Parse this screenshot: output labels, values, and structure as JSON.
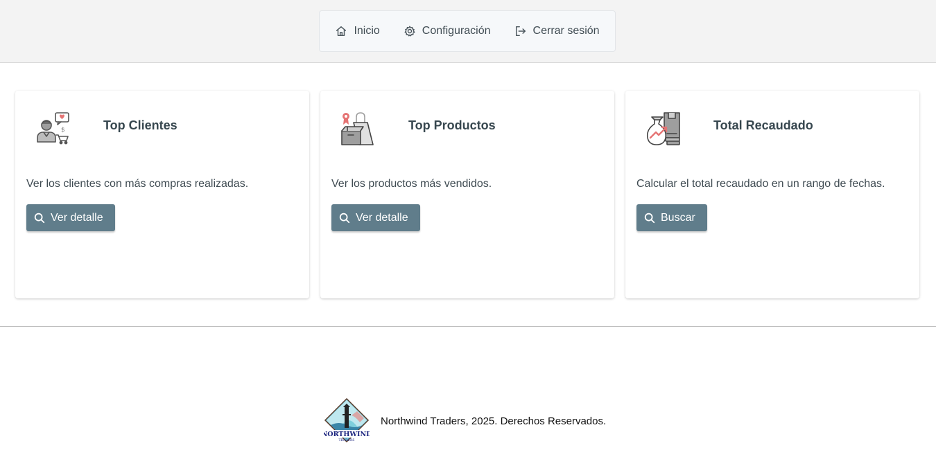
{
  "nav": {
    "items": [
      {
        "label": "Inicio",
        "icon": "home-icon"
      },
      {
        "label": "Configuración",
        "icon": "gear-icon"
      },
      {
        "label": "Cerrar sesión",
        "icon": "logout-icon"
      }
    ]
  },
  "cards": [
    {
      "title": "Top Clientes",
      "icon": "customer-icon",
      "description": "Ver los clientes con más compras realizadas.",
      "button": "Ver detalle",
      "button_icon": "search-icon"
    },
    {
      "title": "Top Productos",
      "icon": "products-icon",
      "description": "Ver los productos más vendidos.",
      "button": "Ver detalle",
      "button_icon": "search-icon"
    },
    {
      "title": "Total Recaudado",
      "icon": "money-bag-icon",
      "description": "Calcular el total recaudado en un rango de fechas.",
      "button": "Buscar",
      "button_icon": "search-icon"
    }
  ],
  "footer": {
    "logo_text": "NORTHWIND",
    "logo_subtext": "TRADERS",
    "text": "Northwind Traders, 2025. Derechos Reservados."
  },
  "colors": {
    "button": "#607d8b",
    "accent_red": "#e57373",
    "topbar": "#f3f3f3"
  }
}
